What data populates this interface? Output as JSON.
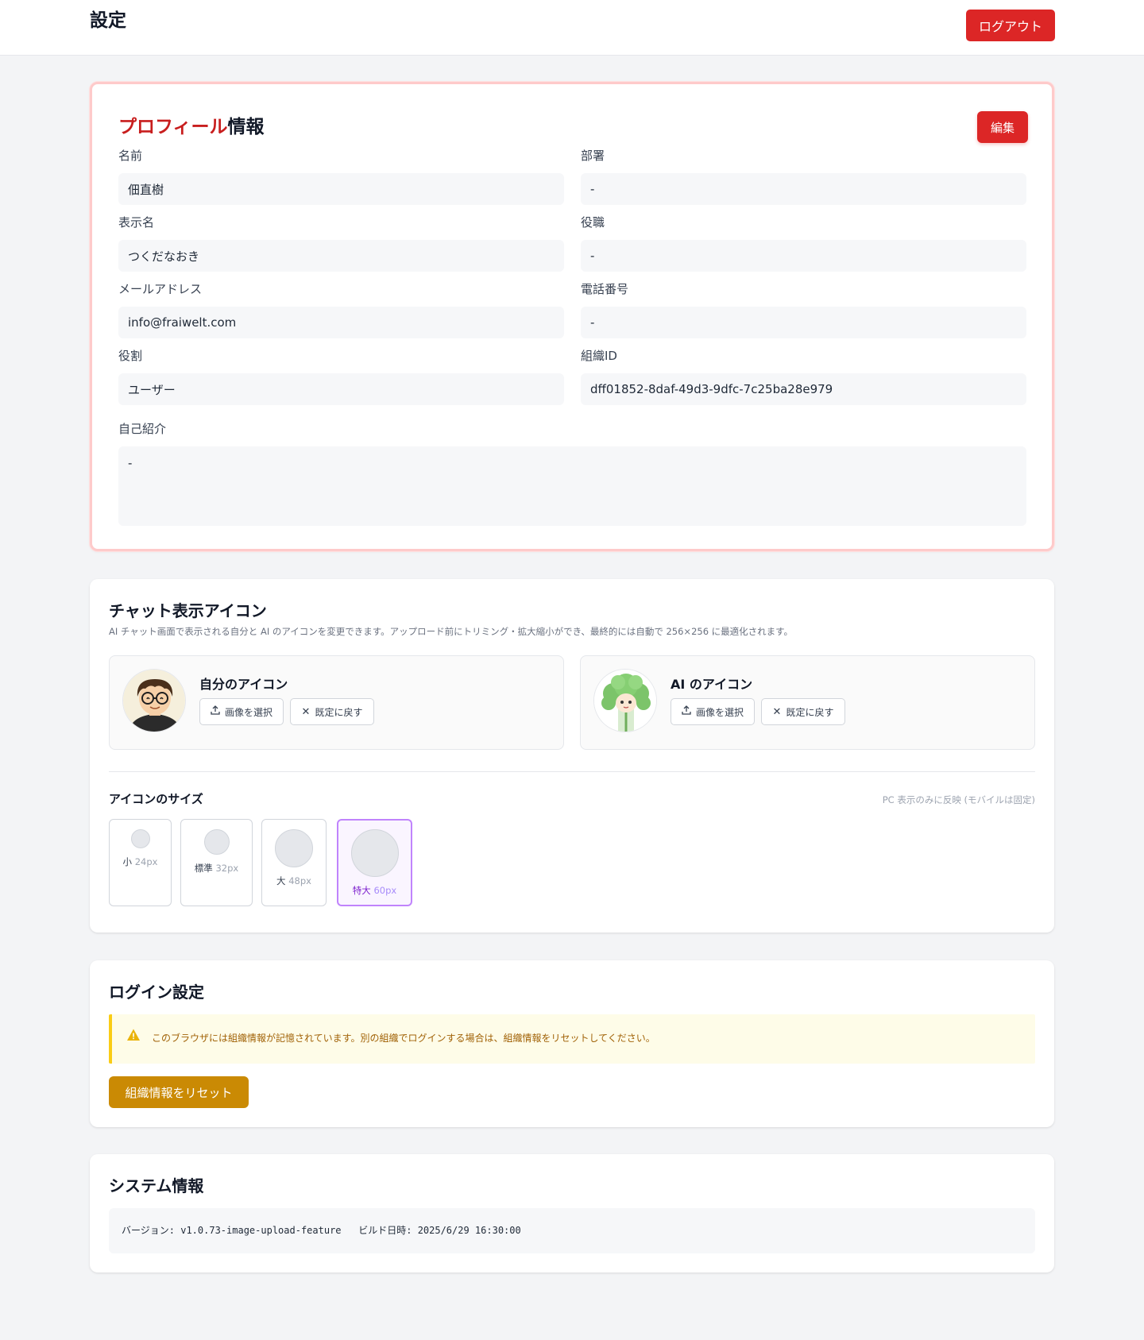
{
  "header": {
    "title": "設定",
    "logout_label": "ログアウト"
  },
  "profile": {
    "title_accent": "プロフィール",
    "title_rest": "情報",
    "edit_label": "編集",
    "fields": {
      "name": {
        "label": "名前",
        "value": "佃直樹"
      },
      "department": {
        "label": "部署",
        "value": "-"
      },
      "display_name": {
        "label": "表示名",
        "value": "つくだなおき"
      },
      "position": {
        "label": "役職",
        "value": "-"
      },
      "email": {
        "label": "メールアドレス",
        "value": "info@fraiwelt.com"
      },
      "phone": {
        "label": "電話番号",
        "value": "-"
      },
      "role": {
        "label": "役割",
        "value": "ユーザー"
      },
      "org_id": {
        "label": "組織ID",
        "value": "dff01852-8daf-49d3-9dfc-7c25ba28e979"
      },
      "bio": {
        "label": "自己紹介",
        "value": "-"
      }
    }
  },
  "chat_icons": {
    "title": "チャット表示アイコン",
    "description": "AI チャット画面で表示される自分と AI のアイコンを変更できます。アップロード前にトリミング・拡大縮小ができ、最終的には自動で 256×256 に最適化されます。",
    "self": {
      "title": "自分のアイコン",
      "select_label": "画像を選択",
      "reset_label": "既定に戻す",
      "avatar_icon": "user-avatar-icon"
    },
    "ai": {
      "title": "AI のアイコン",
      "select_label": "画像を選択",
      "reset_label": "既定に戻す",
      "avatar_icon": "ai-broccoli-avatar-icon"
    },
    "size": {
      "title": "アイコンのサイズ",
      "note": "PC 表示のみに反映 (モバイルは固定)",
      "options": [
        {
          "name": "小",
          "px": "24px",
          "selected": false
        },
        {
          "name": "標準",
          "px": "32px",
          "selected": false
        },
        {
          "name": "大",
          "px": "48px",
          "selected": false
        },
        {
          "name": "特大",
          "px": "60px",
          "selected": true
        }
      ]
    }
  },
  "login": {
    "title": "ログイン設定",
    "warning": "このブラウザには組織情報が記憶されています。別の組織でログインする場合は、組織情報をリセットしてください。",
    "reset_label": "組織情報をリセット"
  },
  "system": {
    "title": "システム情報",
    "version_label": "バージョン:",
    "version": "v1.0.73-image-upload-feature",
    "build_label": "ビルド日時:",
    "build_date": "2025/6/29 16:30:00"
  },
  "colors": {
    "primary_red": "#dc2626",
    "warning_yellow": "#ca8a04",
    "selected_purple": "#c084fc"
  }
}
